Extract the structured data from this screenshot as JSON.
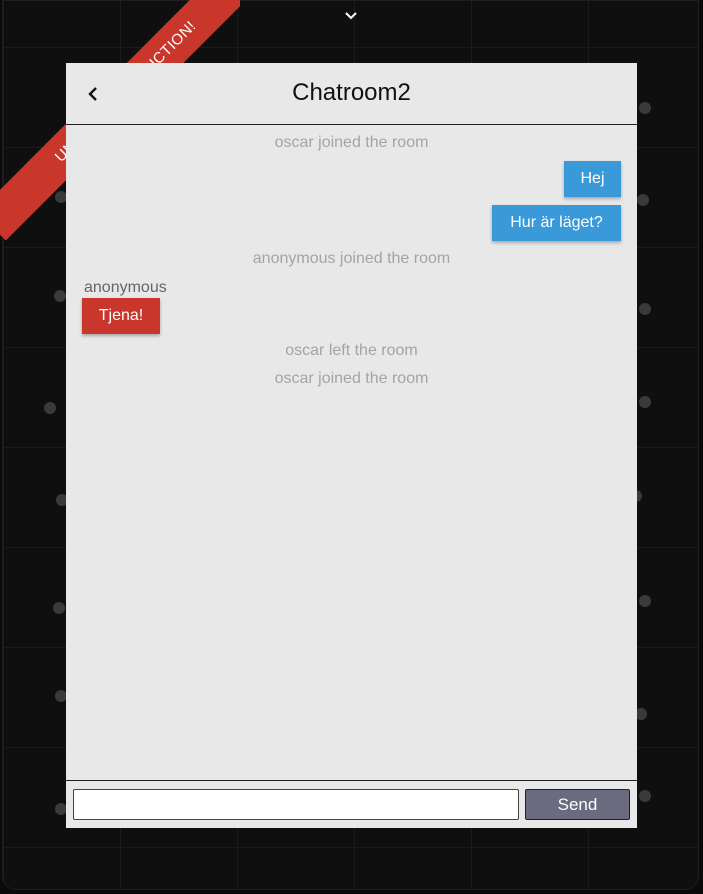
{
  "ribbon": {
    "text": "UNDER CONSTRUCTION!",
    "color": "#c9372c"
  },
  "chat": {
    "title": "Chatroom2",
    "messages": [
      {
        "type": "system",
        "text": "oscar joined the room"
      },
      {
        "type": "own",
        "text": "Hej"
      },
      {
        "type": "own",
        "text": "Hur är läget?"
      },
      {
        "type": "system",
        "text": "anonymous joined the room"
      },
      {
        "type": "other",
        "sender": "anonymous",
        "text": "Tjena!"
      },
      {
        "type": "system",
        "text": "oscar left the room"
      },
      {
        "type": "system",
        "text": "oscar joined the room"
      }
    ]
  },
  "input": {
    "value": "",
    "placeholder": ""
  },
  "send_label": "Send",
  "colors": {
    "own_bubble": "#3a9ad9",
    "other_bubble": "#c9372c",
    "send_button": "#6b6b80",
    "panel": "#e8e8e8"
  },
  "icons": {
    "back": "chevron-left-icon",
    "collapse": "chevron-down-icon"
  }
}
